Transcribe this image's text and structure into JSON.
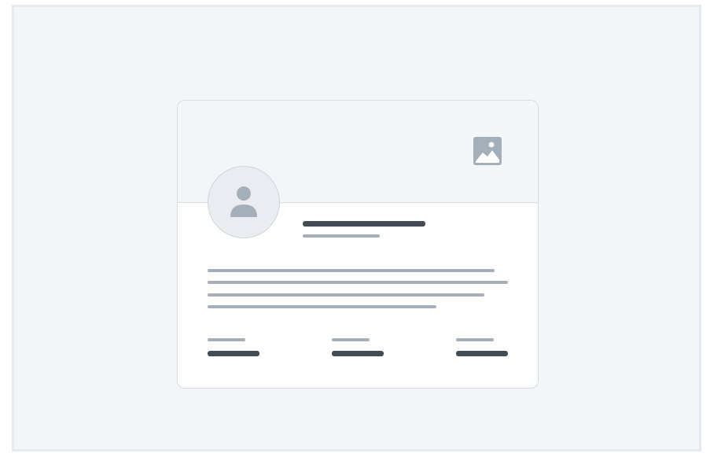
{
  "page": {
    "description_free": true
  },
  "profile_card": {
    "cover_icon": "image-placeholder-icon",
    "avatar_icon": "user-placeholder-icon",
    "skeleton": true
  },
  "colors": {
    "background": "#f3f6f9",
    "card": "#ffffff",
    "border": "#d5dbe1",
    "skeleton_dark": "#434b55",
    "skeleton_light": "#a5afba",
    "icon": "#a5afba"
  }
}
